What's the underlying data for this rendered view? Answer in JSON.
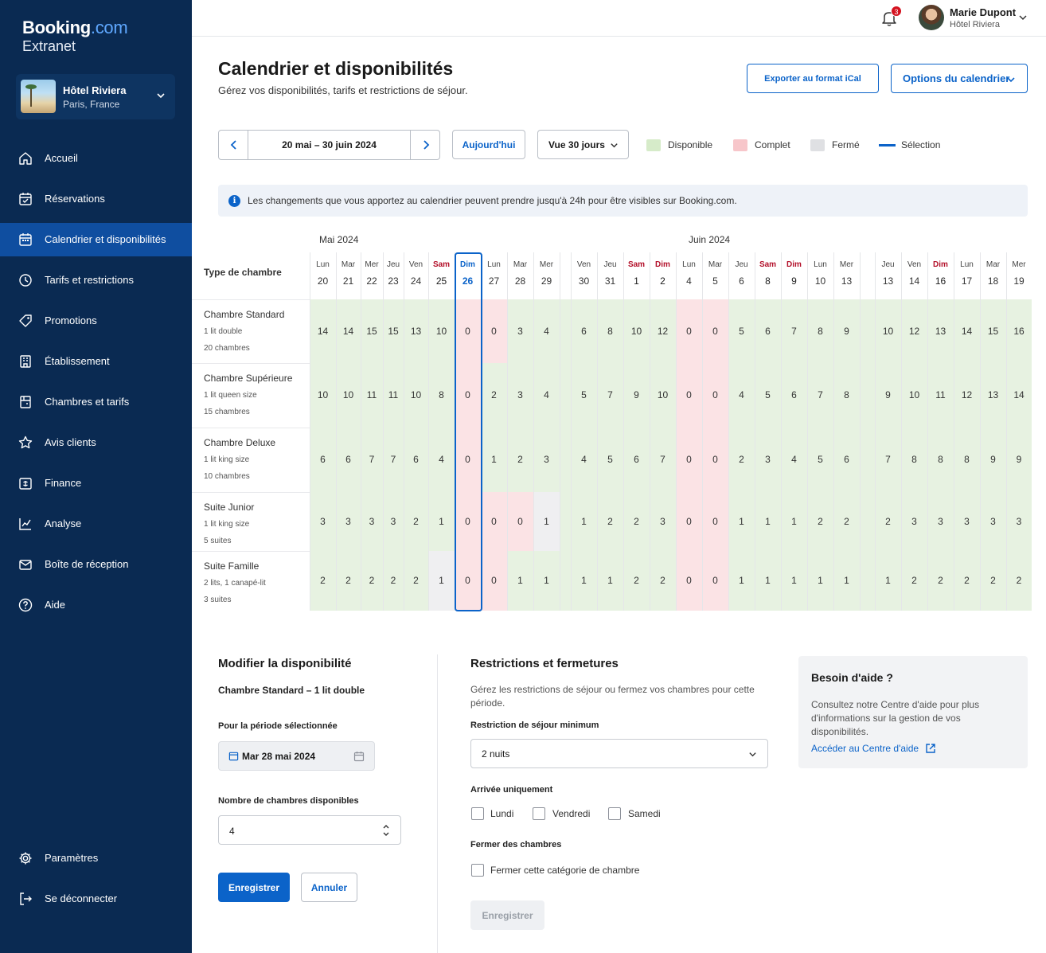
{
  "sidebar": {
    "logo_main": "Booking",
    "logo_com": ".com",
    "logo_sub": "Extranet",
    "hotel_name": "Hôtel Riviera",
    "hotel_location": "Paris, France",
    "items": [
      {
        "label": "Accueil",
        "icon": "home-icon"
      },
      {
        "label": "Réservations",
        "icon": "calendar-check-icon"
      },
      {
        "label": "Calendrier et disponibilités",
        "icon": "calendar-icon"
      },
      {
        "label": "Tarifs et restrictions",
        "icon": "rates-icon"
      },
      {
        "label": "Promotions",
        "icon": "tag-icon"
      },
      {
        "label": "Établissement",
        "icon": "building-icon"
      },
      {
        "label": "Chambres et tarifs",
        "icon": "door-icon"
      },
      {
        "label": "Avis clients",
        "icon": "star-icon"
      },
      {
        "label": "Finance",
        "icon": "finance-icon"
      },
      {
        "label": "Analyse",
        "icon": "chart-icon"
      },
      {
        "label": "Boîte de réception",
        "icon": "mail-icon"
      },
      {
        "label": "Aide",
        "icon": "help-icon"
      }
    ],
    "bottom_items": [
      {
        "label": "Paramètres",
        "icon": "gear-icon"
      },
      {
        "label": "Se déconnecter",
        "icon": "logout-icon"
      }
    ]
  },
  "header": {
    "notification_count": "3",
    "user_name": "Marie Dupont",
    "user_hotel": "Hôtel Riviera"
  },
  "page": {
    "title": "Calendrier et disponibilités",
    "subtitle": "Gérez vos disponibilités, tarifs et restrictions de séjour.",
    "export_label": "Exporter au format iCal",
    "options_label": "Options du calendrier",
    "date_range": "20 mai – 30 juin 2024",
    "today_label": "Aujourd'hui",
    "view_label": "Vue 30 jours",
    "legend": {
      "available": "Disponible",
      "full": "Complet",
      "closed": "Fermé",
      "selection": "Sélection"
    },
    "info_text": "Les changements que vous apportez au calendrier peuvent prendre jusqu'à 24h pour être visibles sur Booking.com."
  },
  "calendar": {
    "room_type_header": "Type de chambre",
    "month1": "Mai 2024",
    "month2": "Juin 2024",
    "days": [
      {
        "n": "Lun",
        "d": "20"
      },
      {
        "n": "Mar",
        "d": "21"
      },
      {
        "n": "Mer",
        "d": "22"
      },
      {
        "n": "Jeu",
        "d": "23"
      },
      {
        "n": "Ven",
        "d": "24"
      },
      {
        "n": "Sam",
        "d": "25"
      },
      {
        "n": "Dim",
        "d": "26"
      },
      {
        "n": "Lun",
        "d": "27"
      },
      {
        "n": "Mar",
        "d": "28"
      },
      {
        "n": "Mer",
        "d": "29"
      },
      {
        "n": "Jeu",
        "d": "30"
      },
      {
        "n": "Ven",
        "d": "30"
      },
      {
        "n": "Jeu",
        "d": "31"
      },
      {
        "n": "Sam",
        "d": "1"
      },
      {
        "n": "Dim",
        "d": "2"
      },
      {
        "n": "Lun",
        "d": "4"
      },
      {
        "n": "Mar",
        "d": "5"
      },
      {
        "n": "Jeu",
        "d": "6"
      },
      {
        "n": "Sam",
        "d": "8"
      },
      {
        "n": "Dim",
        "d": "9"
      },
      {
        "n": "Lun",
        "d": "10"
      },
      {
        "n": "Mer",
        "d": "13"
      },
      {
        "n": "Jeu",
        "d": "13"
      },
      {
        "n": "Jeu",
        "d": "13"
      },
      {
        "n": "Ven",
        "d": "14"
      },
      {
        "n": "Dim",
        "d": "16"
      },
      {
        "n": "Lun",
        "d": "17"
      },
      {
        "n": "Mar",
        "d": "18"
      },
      {
        "n": "Mer",
        "d": "19"
      }
    ],
    "rooms": [
      {
        "name": "Chambre Standard",
        "bed": "1 lit double",
        "count": "20 chambres",
        "values": [
          "14",
          "14",
          "15",
          "15",
          "13",
          "10",
          "0",
          "0",
          "3",
          "4",
          "",
          "6",
          "8",
          "10",
          "12",
          "0",
          "0",
          "5",
          "6",
          "7",
          "8",
          "9",
          "",
          "10",
          "12",
          "13",
          "14",
          "15",
          "16"
        ]
      },
      {
        "name": "Chambre Supérieure",
        "bed": "1 lit queen size",
        "count": "15 chambres",
        "values": [
          "10",
          "10",
          "11",
          "11",
          "10",
          "8",
          "0",
          "2",
          "3",
          "4",
          "",
          "5",
          "7",
          "9",
          "10",
          "0",
          "0",
          "4",
          "5",
          "6",
          "7",
          "8",
          "",
          "9",
          "10",
          "11",
          "12",
          "13",
          "14"
        ]
      },
      {
        "name": "Chambre Deluxe",
        "bed": "1 lit king size",
        "count": "10 chambres",
        "values": [
          "6",
          "6",
          "7",
          "7",
          "6",
          "4",
          "0",
          "1",
          "2",
          "3",
          "",
          "4",
          "5",
          "6",
          "7",
          "0",
          "0",
          "2",
          "3",
          "4",
          "5",
          "6",
          "",
          "7",
          "8",
          "8",
          "8",
          "9",
          "9"
        ]
      },
      {
        "name": "Suite Junior",
        "bed": "1 lit king size",
        "count": "5 suites",
        "values": [
          "3",
          "3",
          "3",
          "3",
          "2",
          "1",
          "0",
          "0",
          "0",
          "1",
          "",
          "1",
          "2",
          "2",
          "3",
          "0",
          "0",
          "1",
          "1",
          "1",
          "2",
          "2",
          "",
          "2",
          "3",
          "3",
          "3",
          "3",
          "3"
        ]
      },
      {
        "name": "Suite Famille",
        "bed": "2 lits, 1 canapé-lit",
        "count": "3 suites",
        "values": [
          "2",
          "2",
          "2",
          "2",
          "2",
          "1",
          "0",
          "0",
          "1",
          "1",
          "",
          "1",
          "1",
          "2",
          "2",
          "0",
          "0",
          "1",
          "1",
          "1",
          "1",
          "1",
          "",
          "1",
          "2",
          "2",
          "2",
          "2",
          "2"
        ]
      }
    ]
  },
  "edit": {
    "title": "Modifier la disponibilité",
    "room": "Chambre Standard – 1 lit double",
    "period_label": "Pour la période sélectionnée",
    "period_value": "Mar 28 mai 2024",
    "count_label": "Nombre de chambres disponibles",
    "count_value": "4",
    "save": "Enregistrer",
    "cancel": "Annuler"
  },
  "restrictions": {
    "title": "Restrictions et fermetures",
    "desc": "Gérez les restrictions de séjour ou fermez vos chambres pour cette période.",
    "min_stay_label": "Restriction de séjour minimum",
    "min_stay_value": "2 nuits",
    "arrival_label": "Arrivée uniquement",
    "days": [
      "Lundi",
      "Vendredi",
      "Samedi"
    ],
    "close_label": "Fermer des chambres",
    "close_option": "Fermer cette catégorie de chambre",
    "save": "Enregistrer"
  },
  "help": {
    "title": "Besoin d'aide ?",
    "text": "Consultez notre Centre d'aide pour plus d'informations sur la gestion de vos disponibilités.",
    "link": "Accéder au Centre d'aide"
  }
}
